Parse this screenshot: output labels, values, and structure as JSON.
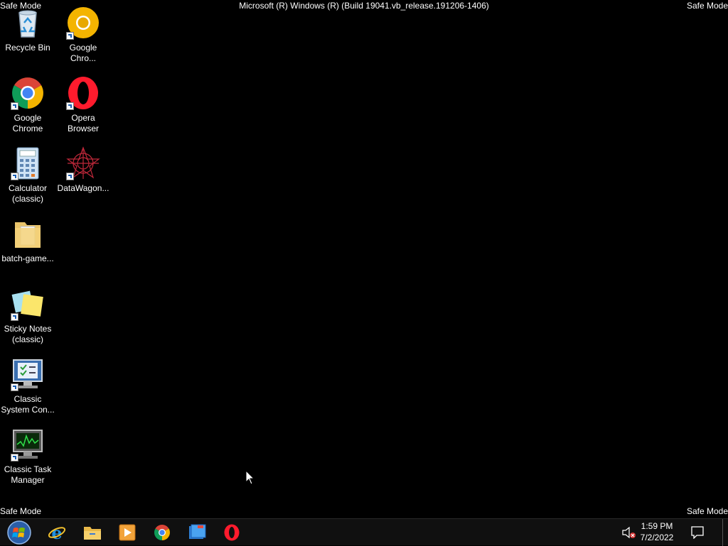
{
  "safe_mode": {
    "top_left": "Safe Mode",
    "top_right": "Safe Mode",
    "bottom_left": "Safe Mode",
    "bottom_right": "Safe Mode"
  },
  "build_text": "Microsoft (R) Windows (R) (Build 19041.vb_release.191206-1406)",
  "desktop_icons": [
    {
      "label": "Recycle Bin",
      "icon": "recycle-bin-icon"
    },
    {
      "label": "Google\nChro...",
      "icon": "chrome-canary-icon"
    },
    {
      "label": "Google\nChrome",
      "icon": "chrome-icon"
    },
    {
      "label": "Opera\nBrowser",
      "icon": "opera-icon"
    },
    {
      "label": "Calculator\n(classic)",
      "icon": "calculator-icon"
    },
    {
      "label": "DataWagon...",
      "icon": "datawagon-icon"
    },
    {
      "label": "batch-game...",
      "icon": "folder-icon"
    },
    {
      "label": "Sticky Notes\n(classic)",
      "icon": "sticky-notes-icon"
    },
    {
      "label": "Classic\nSystem Con...",
      "icon": "system-config-icon"
    },
    {
      "label": "Classic Task\nManager",
      "icon": "task-manager-icon"
    }
  ],
  "taskbar": {
    "pinned": [
      {
        "name": "internet-explorer-icon"
      },
      {
        "name": "file-explorer-icon"
      },
      {
        "name": "media-player-icon"
      },
      {
        "name": "chrome-icon"
      },
      {
        "name": "windows-explorer-folder-icon"
      },
      {
        "name": "opera-icon"
      }
    ],
    "clock": {
      "time": "1:59 PM",
      "date": "7/2/2022"
    }
  },
  "colors": {
    "desktop_bg": "#000000",
    "taskbar_bg": "#101010",
    "text": "#ffffff"
  }
}
